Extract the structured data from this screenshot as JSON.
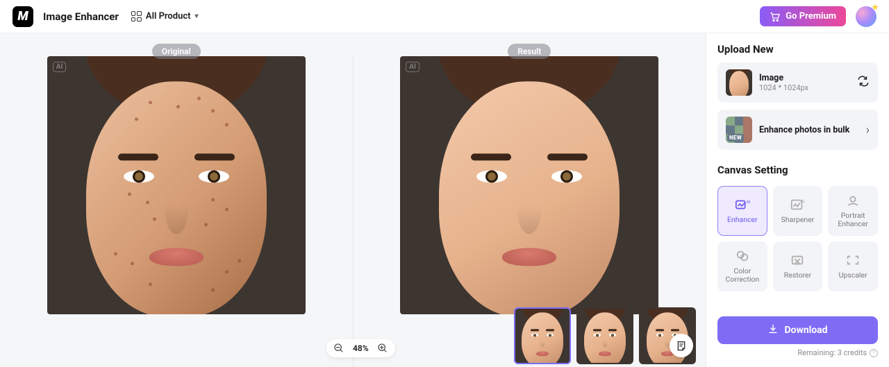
{
  "header": {
    "app_title": "Image Enhancer",
    "all_product_label": "All Product",
    "go_premium_label": "Go Premium"
  },
  "canvas": {
    "original_label": "Original",
    "result_label": "Result",
    "zoom_level": "48%",
    "ai_watermark": "AI"
  },
  "thumbs": {
    "count": 3,
    "selected_index": 0
  },
  "sidebar": {
    "upload_title": "Upload New",
    "image": {
      "label": "Image",
      "dimensions": "1024 * 1024px"
    },
    "bulk": {
      "label": "Enhance photos in bulk",
      "tag": "NEW"
    },
    "canvas_setting_title": "Canvas Setting",
    "tools": [
      {
        "key": "enhancer",
        "label": "Enhancer",
        "active": true
      },
      {
        "key": "sharpener",
        "label": "Sharpener",
        "active": false
      },
      {
        "key": "portrait-enhancer",
        "label": "Portrait Enhancer",
        "active": false
      },
      {
        "key": "color-correction",
        "label": "Color Correction",
        "active": false
      },
      {
        "key": "restorer",
        "label": "Restorer",
        "active": false
      },
      {
        "key": "upscaler",
        "label": "Upscaler",
        "active": false
      }
    ],
    "download_label": "Download",
    "remaining_label": "Remaining: 3 credits"
  }
}
